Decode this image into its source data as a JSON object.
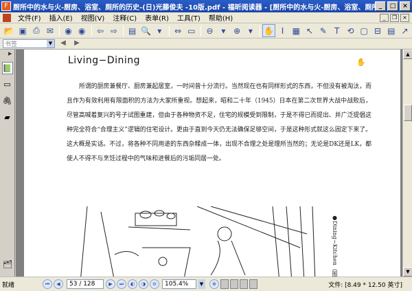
{
  "window": {
    "title": "厨所中的水与火-厨房、浴室、厕所的历史-(日)光藤俊夫 -10版.pdf - 福昕阅读器 - [厨所中的水与火-厨房、浴室、厕所的历史-(日)光藤俊夫 -10版.p...",
    "app_icon_label": "F"
  },
  "menu": [
    "文件(F)",
    "插入(E)",
    "视图(V)",
    "注释(C)",
    "表单(R)",
    "工具(T)",
    "帮助(H)"
  ],
  "bookmark_search": {
    "placeholder": "书签"
  },
  "document": {
    "heading": "Living−Dining",
    "paragraph": "所谓的厨房兼餐厅、厨房兼起居室，一时间曾十分流行。当然现在也有同样形式的东西，不但没有被淘汰，而且作为有效利用有限面积的方法为大家所重视。想起来，昭和二十年（1945）日本在第二次世界大战中战败后，尽管高喊着复兴的号子试图重建，但由于各种物资不足，住宅的规模受到限制，于是不得已而提出、并广泛提倡这种完全符合“合理主义”逻辑的住宅设计。更由于直到今天仍无法确保足够空间，于是这种形式就这么固定下来了。这大概是实话。不过，将各种不同用途的东西杂糅成一体，出现不合理之处是理所当然的；无论是DK还是LK，都使人不得不与烹饪过程中的气味和进餐后的污垢同居一处。",
    "caption": "●Dining−Kitchen（图"
  },
  "status": {
    "text": "就绪",
    "page": "53 / 128",
    "zoom": "105.4%",
    "file_size": "文件: [8.49 * 12.50 英寸]"
  }
}
